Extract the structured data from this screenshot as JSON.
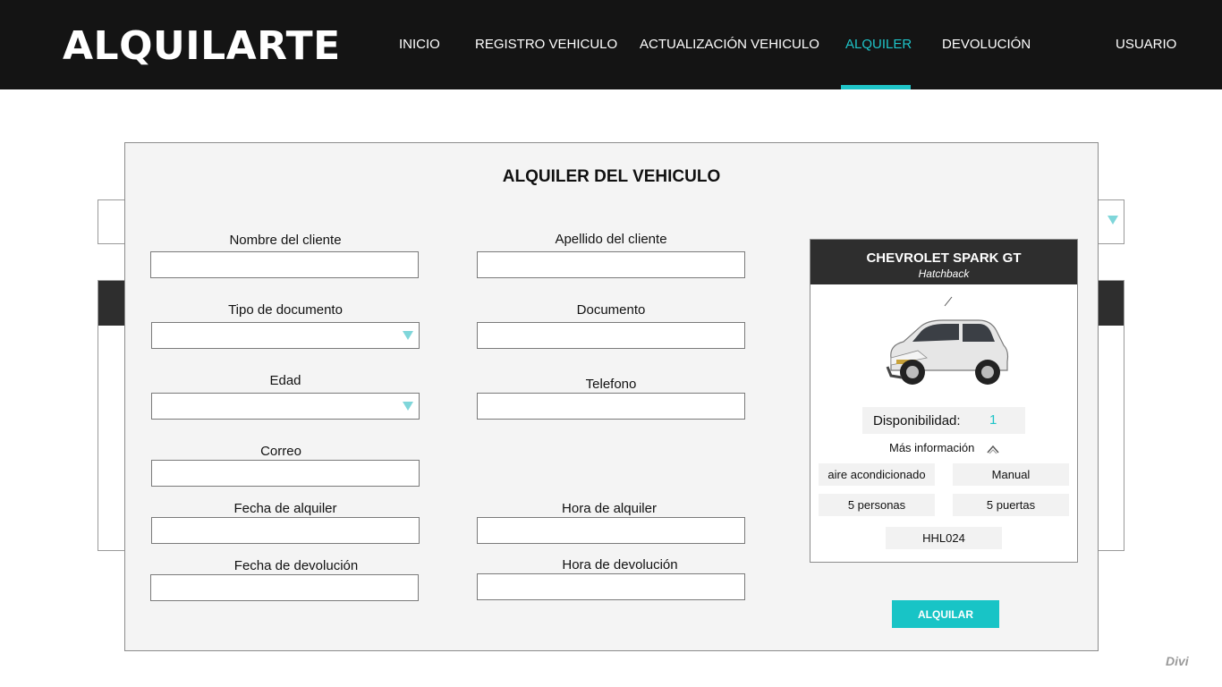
{
  "header": {
    "logo": "ALQUILARTE",
    "nav": [
      "INICIO",
      "REGISTRO VEHICULO",
      "ACTUALIZACIÓN VEHICULO",
      "ALQUILER",
      "DEVOLUCIÓN"
    ],
    "active_nav": "ALQUILER",
    "user": "USUARIO",
    "accent_color": "#1fc4c8"
  },
  "modal": {
    "title": "ALQUILER DEL VEHICULO",
    "fields": {
      "nombre": {
        "label": "Nombre del cliente",
        "value": ""
      },
      "apellido": {
        "label": "Apellido del cliente",
        "value": ""
      },
      "tipo_documento": {
        "label": "Tipo de documento",
        "value": ""
      },
      "documento": {
        "label": "Documento",
        "value": ""
      },
      "edad": {
        "label": "Edad",
        "value": ""
      },
      "telefono": {
        "label": "Telefono",
        "value": ""
      },
      "correo": {
        "label": "Correo",
        "value": ""
      },
      "fecha_alquiler": {
        "label": "Fecha de alquiler",
        "value": ""
      },
      "hora_alquiler": {
        "label": "Hora de alquiler",
        "value": ""
      },
      "fecha_devolucion": {
        "label": "Fecha de devolución",
        "value": ""
      },
      "hora_devolucion": {
        "label": "Hora de devolución",
        "value": ""
      }
    },
    "submit_label": "ALQUILAR"
  },
  "car": {
    "name": "CHEVROLET SPARK GT",
    "type": "Hatchback",
    "availability_label": "Disponibilidad:",
    "availability_value": "1",
    "more_info": "Más información",
    "specs": [
      "aire acondicionado",
      "Manual",
      "5 personas",
      "5 puertas",
      "HHL024"
    ]
  },
  "footer": {
    "watermark": "Divi"
  }
}
